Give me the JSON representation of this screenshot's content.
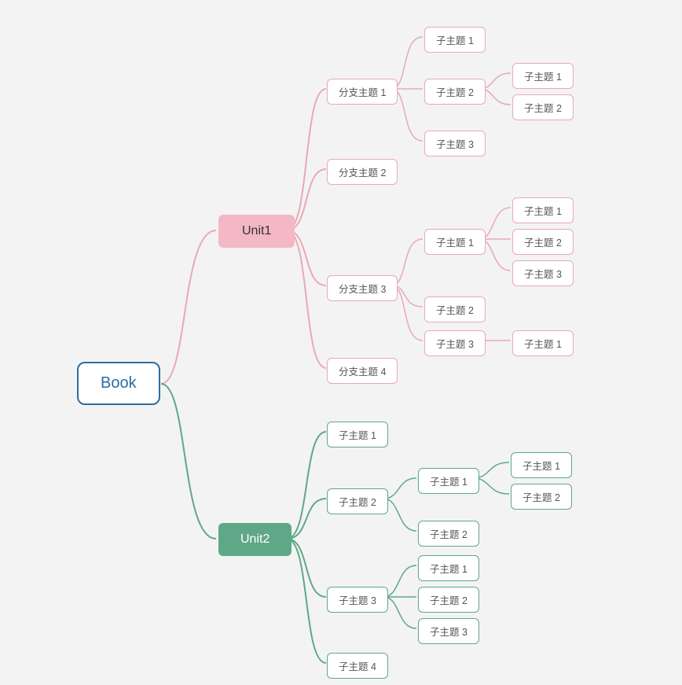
{
  "root": {
    "label": "Book"
  },
  "unit1": {
    "label": "Unit1",
    "branches": [
      {
        "label": "分支主题 1",
        "children": [
          {
            "label": "子主题 1"
          },
          {
            "label": "子主题 2",
            "children": [
              {
                "label": "子主题 1"
              },
              {
                "label": "子主题 2"
              }
            ]
          },
          {
            "label": "子主题 3"
          }
        ]
      },
      {
        "label": "分支主题 2"
      },
      {
        "label": "分支主题 3",
        "children": [
          {
            "label": "子主题 1",
            "children": [
              {
                "label": "子主题 1"
              },
              {
                "label": "子主题 2"
              },
              {
                "label": "子主题 3"
              }
            ]
          },
          {
            "label": "子主题 2"
          },
          {
            "label": "子主题 3",
            "children": [
              {
                "label": "子主题 1"
              }
            ]
          }
        ]
      },
      {
        "label": "分支主题 4"
      }
    ]
  },
  "unit2": {
    "label": "Unit2",
    "branches": [
      {
        "label": "子主题 1"
      },
      {
        "label": "子主题 2",
        "children": [
          {
            "label": "子主题 1",
            "children": [
              {
                "label": "子主题 1"
              },
              {
                "label": "子主题 2"
              }
            ]
          },
          {
            "label": "子主题 2"
          }
        ]
      },
      {
        "label": "子主题 3",
        "children": [
          {
            "label": "子主题 1"
          },
          {
            "label": "子主题 2"
          },
          {
            "label": "子主题 3"
          }
        ]
      },
      {
        "label": "子主题 4"
      }
    ]
  }
}
